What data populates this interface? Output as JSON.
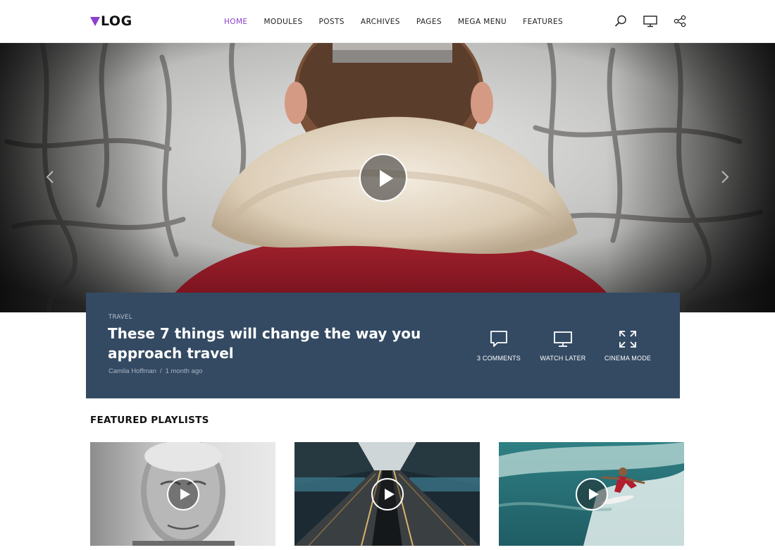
{
  "brand": {
    "logo_text": "LOG",
    "accent_color": "#8e3fcc"
  },
  "nav": {
    "items": [
      "HOME",
      "MODULES",
      "POSTS",
      "ARCHIVES",
      "PAGES",
      "MEGA MENU",
      "FEATURES"
    ],
    "active": "HOME"
  },
  "header_icons": [
    "search-icon",
    "monitor-icon",
    "share-icon"
  ],
  "hero": {
    "category": "TRAVEL",
    "title": "These 7 things will change the way you approach travel",
    "author": "Camila Hoffman",
    "date": "1 month ago",
    "separator": "/",
    "actions": [
      {
        "label": "3 COMMENTS",
        "icon": "comment-icon"
      },
      {
        "label": "WATCH LATER",
        "icon": "monitor-icon"
      },
      {
        "label": "CINEMA MODE",
        "icon": "expand-icon"
      }
    ],
    "card_color": "#344a63"
  },
  "featured": {
    "title": "FEATURED PLAYLISTS"
  }
}
